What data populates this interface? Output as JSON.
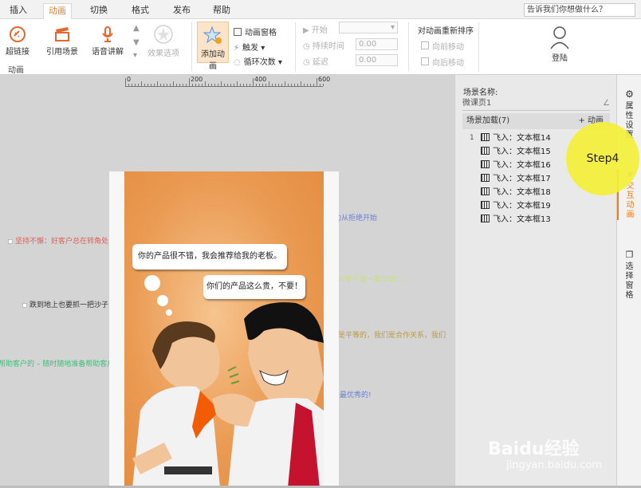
{
  "tabs": [
    {
      "label": "插入"
    },
    {
      "label": "动画",
      "active": true
    },
    {
      "label": "切换"
    },
    {
      "label": "格式"
    },
    {
      "label": "发布"
    },
    {
      "label": "帮助"
    }
  ],
  "search": {
    "placeholder": "告诉我们你想做什么？"
  },
  "ribbon": {
    "hyperlink": "超链接",
    "reference_scene": "引用场景",
    "voice_narration": "语音讲解",
    "effect_options": "效果选项",
    "group_animation": "动画",
    "add_animation": "添加动画",
    "animation_pane": "动画窗格",
    "trigger": "触发",
    "loop_count": "循环次数",
    "start": "开始",
    "duration": "持续时间",
    "delay": "延迟",
    "duration_value": "0.00",
    "delay_value": "0.00",
    "reorder_title": "对动画重新排序",
    "move_earlier": "向前移动",
    "move_later": "向后移动",
    "login": "登陆"
  },
  "ruler": {
    "labels": [
      "0",
      "200",
      "400",
      "600"
    ]
  },
  "slide": {
    "bubble1": "你的产品很不错，我会推荐给我的老板。",
    "bubble2": "你们的产品这么贵，不要！"
  },
  "notes": [
    {
      "text": "坚持不懈：好客户总在转角处！",
      "color": "#e0605a"
    },
    {
      "text": "跌到地上也要抓一把沙子！",
      "color": "#333333"
    },
    {
      "text": "帮助客户的 – 随时随地准备帮助客户！",
      "color": "#3bbf7a"
    },
    {
      "text": "成功从拒绝开始",
      "color": "#6a7fd6"
    },
    {
      "text": "最好的客户是一家公司……",
      "color": "#c7e07a"
    },
    {
      "text": "我们是平等的，我们是合作关系，我们",
      "color": "#b89a4a"
    },
    {
      "text": "我是最优秀的!",
      "color": "#6a7fd6"
    }
  ],
  "panel": {
    "scene_name_label": "场景名称:",
    "scene_name_value": "微课页1",
    "scene_load": "场景加载(7)",
    "add_animation": "+ 动画",
    "first_index": "1",
    "animations": [
      {
        "label": "飞入：文本框14"
      },
      {
        "label": "飞入：文本框15"
      },
      {
        "label": "飞入：文本框16"
      },
      {
        "label": "飞入：文本框17"
      },
      {
        "label": "飞入：文本框18"
      },
      {
        "label": "飞入：文本框19"
      },
      {
        "label": "飞入：文本框13"
      }
    ]
  },
  "vtabs": {
    "properties": "属性设置",
    "interactive_animation": "交互动画",
    "selection_pane": "选择窗格"
  },
  "overlay": {
    "step_label": "Step4",
    "watermark": "Baidu经验",
    "watermark_url": "jingyan.baidu.com"
  },
  "colors": {
    "accent": "#e67e22",
    "highlight": "#f4f03a"
  }
}
